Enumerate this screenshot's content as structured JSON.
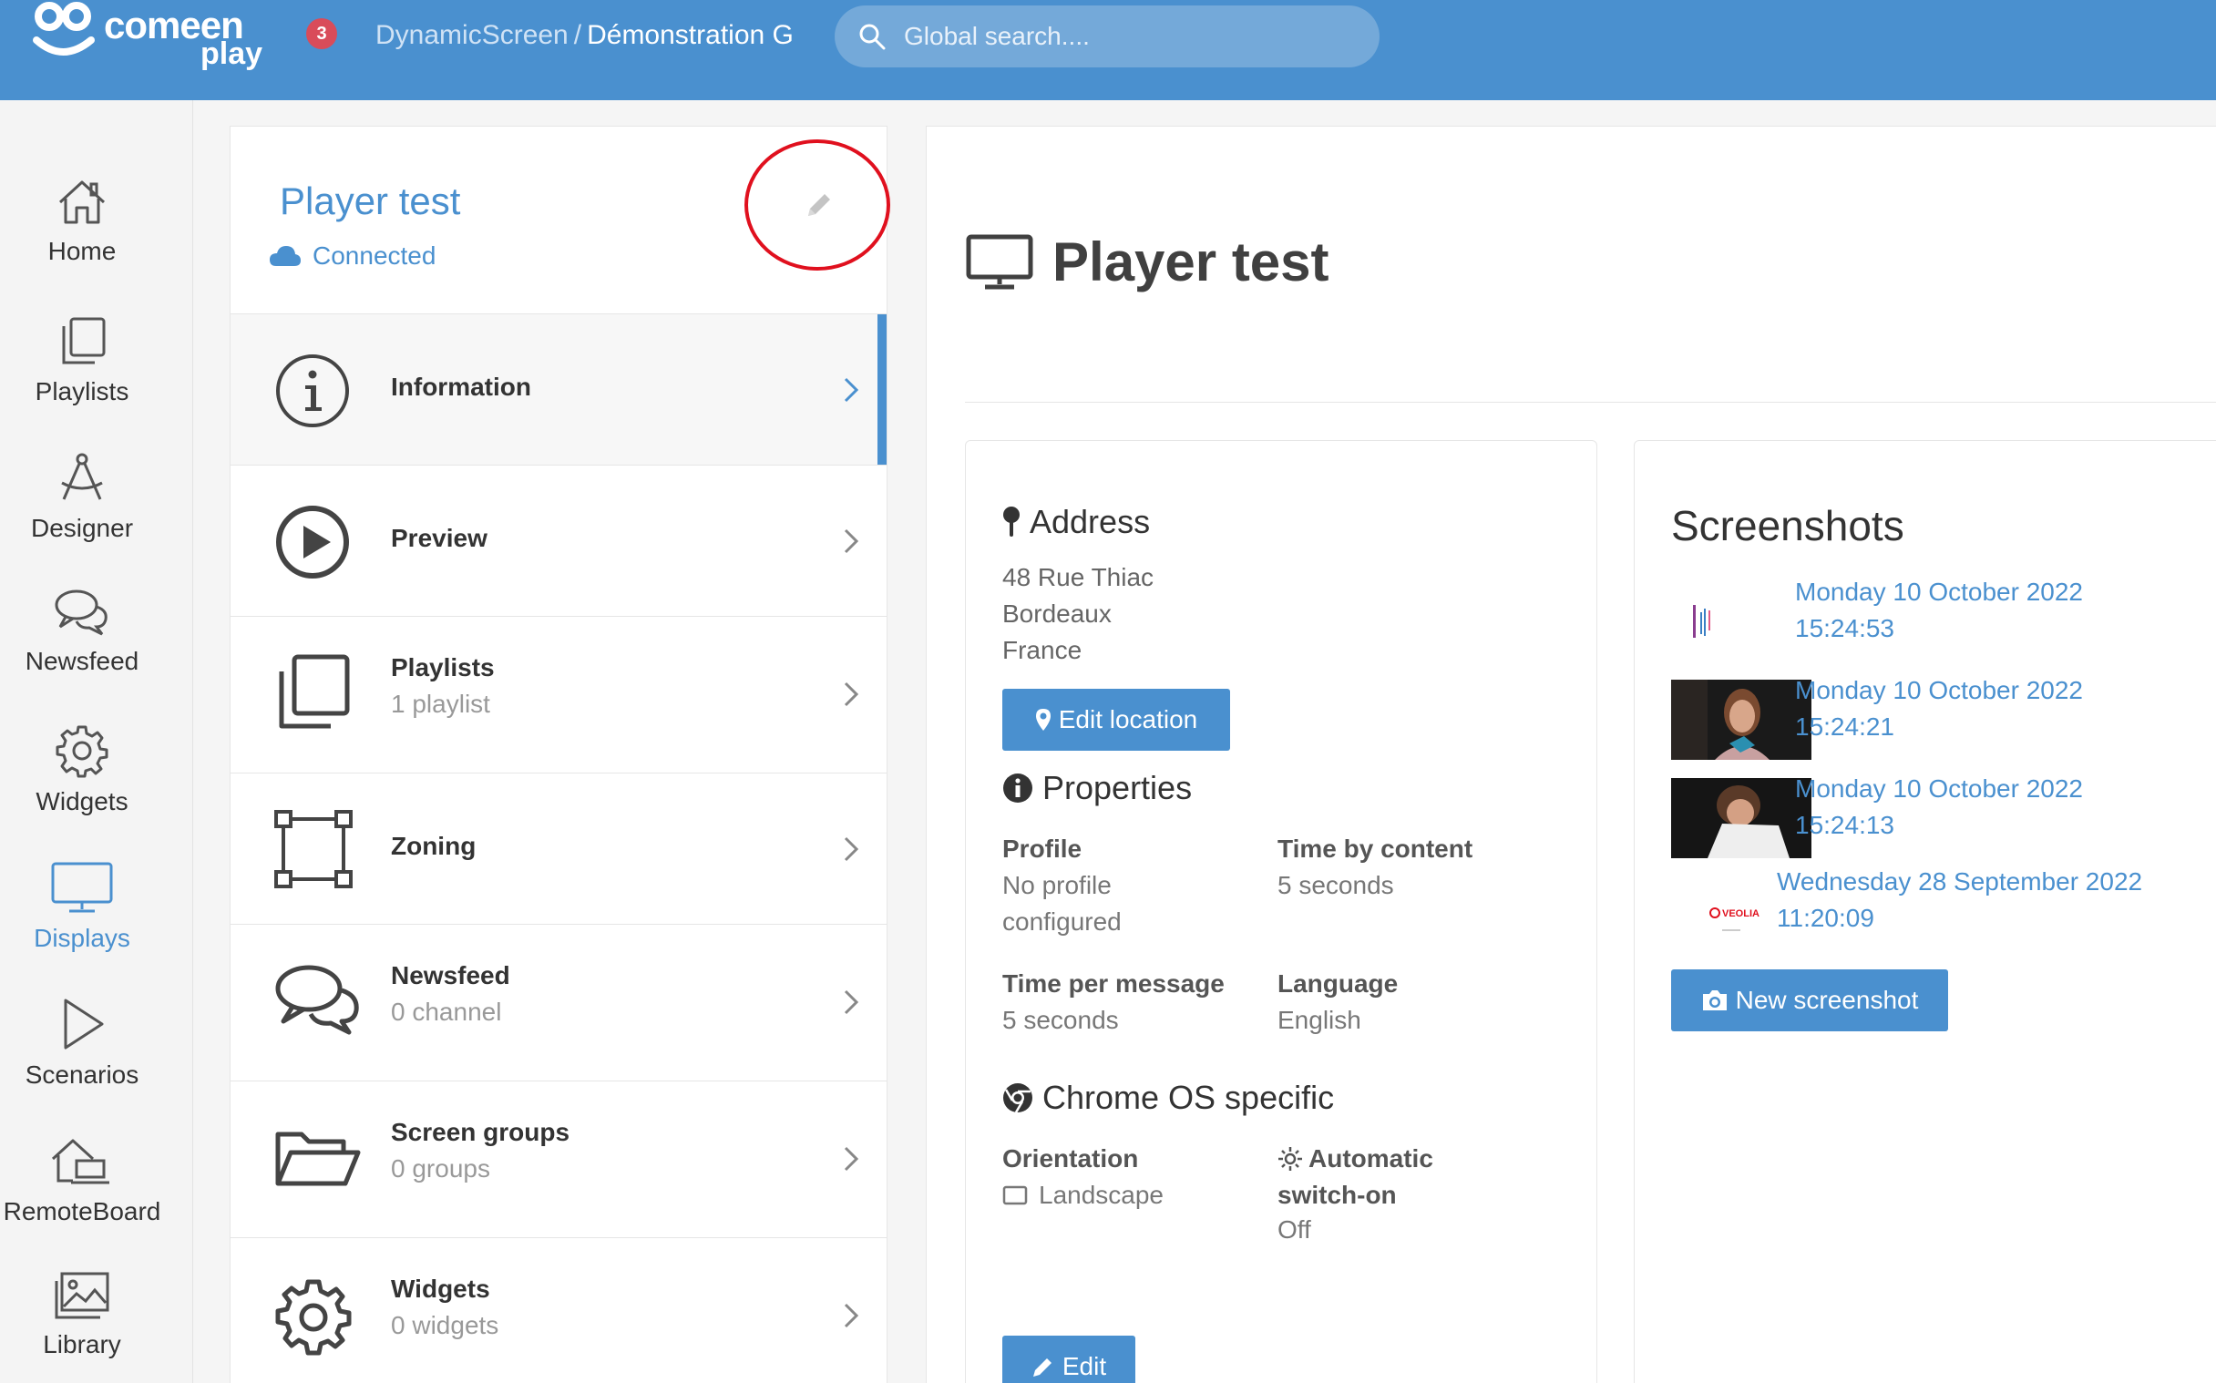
{
  "app": {
    "logo_main": "comeen",
    "logo_sub": "play",
    "notification_count": "3",
    "brand_color": "#4a90cf"
  },
  "breadcrumb": {
    "parent": "DynamicScreen",
    "separator": "/",
    "current": "Démonstration G"
  },
  "search": {
    "placeholder": "Global search...."
  },
  "nav": {
    "items": [
      {
        "label": "Home",
        "icon": "home-icon"
      },
      {
        "label": "Playlists",
        "icon": "playlists-icon"
      },
      {
        "label": "Designer",
        "icon": "designer-icon"
      },
      {
        "label": "Newsfeed",
        "icon": "newsfeed-icon"
      },
      {
        "label": "Widgets",
        "icon": "gear-icon"
      },
      {
        "label": "Displays",
        "icon": "monitor-icon",
        "active": true
      },
      {
        "label": "Scenarios",
        "icon": "play-icon"
      },
      {
        "label": "RemoteBoard",
        "icon": "remoteboard-icon"
      },
      {
        "label": "Library",
        "icon": "library-icon"
      }
    ]
  },
  "player": {
    "name": "Player test",
    "status": "Connected"
  },
  "menu": [
    {
      "label": "Information",
      "sub": "",
      "icon": "info-icon",
      "selected": true
    },
    {
      "label": "Preview",
      "sub": "",
      "icon": "play-circle-icon"
    },
    {
      "label": "Playlists",
      "sub": "1 playlist",
      "icon": "playlists-icon"
    },
    {
      "label": "Zoning",
      "sub": "",
      "icon": "zoning-icon"
    },
    {
      "label": "Newsfeed",
      "sub": "0 channel",
      "icon": "newsfeed-icon"
    },
    {
      "label": "Screen groups",
      "sub": "0 groups",
      "icon": "folder-icon"
    },
    {
      "label": "Widgets",
      "sub": "0 widgets",
      "icon": "gear-icon"
    }
  ],
  "page": {
    "title": "Player test"
  },
  "address": {
    "heading": "Address",
    "lines": [
      "48 Rue Thiac",
      "Bordeaux",
      "France"
    ],
    "edit_label": "Edit location"
  },
  "properties": {
    "heading": "Properties",
    "items": [
      {
        "label": "Profile",
        "value_lines": [
          "No profile",
          "configured"
        ]
      },
      {
        "label": "Time by content",
        "value_lines": [
          "5 seconds"
        ]
      },
      {
        "label": "Time per message",
        "value_lines": [
          "5 seconds"
        ]
      },
      {
        "label": "Language",
        "value_lines": [
          "English"
        ]
      }
    ]
  },
  "chrome_os": {
    "heading": "Chrome OS specific",
    "orientation_label": "Orientation",
    "orientation_value": "Landscape",
    "auto_switch_label_1": "Automatic",
    "auto_switch_label_2": "switch-on",
    "auto_switch_value": "Off",
    "edit_label": "Edit"
  },
  "screenshots": {
    "heading": "Screenshots",
    "items": [
      {
        "date": "Monday 10 October 2022",
        "time": "15:24:53"
      },
      {
        "date": "Monday 10 October 2022",
        "time": "15:24:21"
      },
      {
        "date": "Monday 10 October 2022",
        "time": "15:24:13"
      },
      {
        "date": "Wednesday 28 September 2022",
        "time": "11:20:09"
      }
    ],
    "thumb_brand_text": "VEOLIA",
    "new_label": "New screenshot"
  }
}
